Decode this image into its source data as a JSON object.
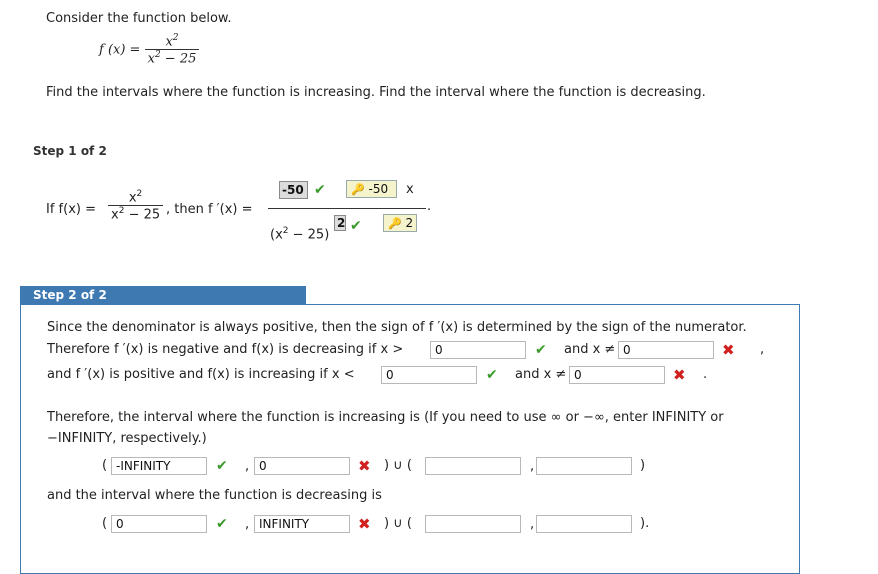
{
  "intro": {
    "consider": "Consider the function below.",
    "f_lhs": "f (x) =",
    "f_num": "x",
    "f_den_pre": "x",
    "f_den_post": " − 25",
    "exp": "2",
    "find": "Find the intervals where the function is increasing. Find the interval where the function is decreasing."
  },
  "step1": {
    "label": "Step 1 of 2",
    "if_text": "If  f(x)  =",
    "num": "x",
    "den_pre": "x",
    "den_post": " − 25",
    "exp": "2",
    "then_text": ", then  f ′(x)  =",
    "answer_num": "-50",
    "hint_num": "-50",
    "times": "x",
    "den_expr": "(x",
    "den_expr2": " − 25)",
    "answer_pow": "2",
    "hint_pow": "2",
    "period": "."
  },
  "step2": {
    "label": "Step 2 of 2",
    "line1": "Since the denominator is always positive, then the sign of  f ′(x)  is determined by the sign of the numerator.",
    "line2_pre": "Therefore  f ′(x)  is negative and  f(x)  is decreasing if x >",
    "line2_val1": "0",
    "and_x_ne": "and x ≠",
    "line2_val2": "0",
    "comma": ",",
    "line3_pre": "and  f ′(x)  is positive and  f(x)  is increasing if x <",
    "line3_val1": "0",
    "line3_val2": "0",
    "period": ".",
    "therefore_line1": "Therefore, the interval where the function is increasing is (If you need to use ∞ or −∞, enter INFINITY or",
    "therefore_line2": "−INFINITY, respectively.)",
    "inc_open": "(",
    "inc_a": "-INFINITY",
    "inc_sep": ",",
    "inc_b": "0",
    "union": ")  ∪  (",
    "inc_c": "",
    "inc_sep2": ",",
    "inc_d": "",
    "inc_close": ")",
    "dec_text": "and the interval where the function is decreasing is",
    "dec_open": "(",
    "dec_a": "0",
    "dec_sep": ",",
    "dec_b": "INFINITY",
    "dec_union": ")  ∪  (",
    "dec_c": "",
    "dec_sep2": ",",
    "dec_d": "",
    "dec_close": ")."
  },
  "icons": {
    "check": "✔",
    "cross": "✖",
    "key": "🔑"
  },
  "colors": {
    "correct": "#3a9a2a",
    "incorrect": "#d02020",
    "step_header": "#3e79b2"
  }
}
